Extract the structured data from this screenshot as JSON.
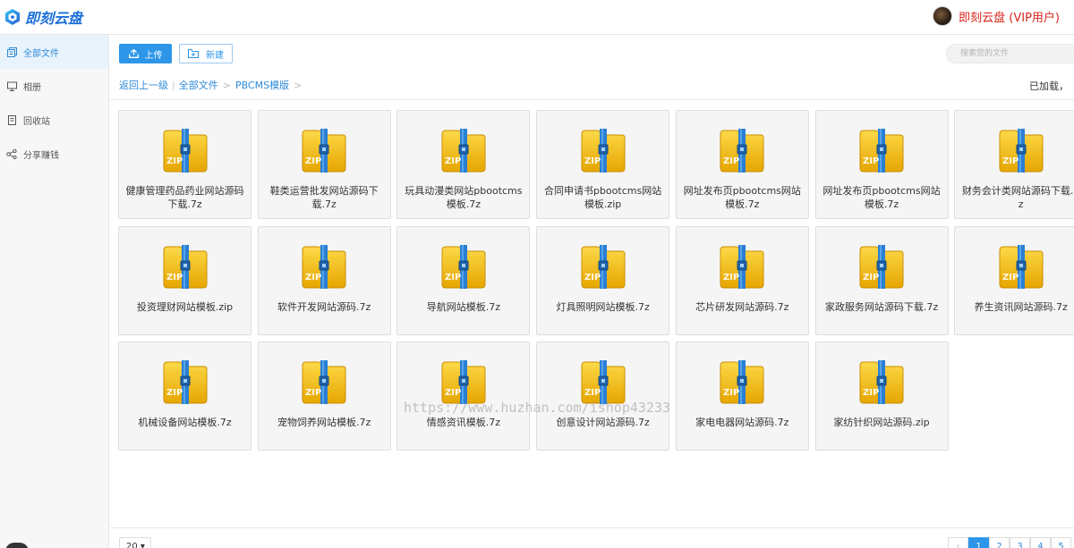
{
  "app": {
    "logo_text": "即刻云盘",
    "user_name": "即刻云盘 (VIP用户)"
  },
  "sidebar": {
    "items": [
      {
        "label": "全部文件",
        "icon": "files-icon",
        "active": true
      },
      {
        "label": "相册",
        "icon": "monitor-icon",
        "active": false
      },
      {
        "label": "回收站",
        "icon": "trash-icon",
        "active": false
      },
      {
        "label": "分享赚钱",
        "icon": "share-icon",
        "active": false
      }
    ]
  },
  "toolbar": {
    "upload_label": "上传",
    "new_label": "新建",
    "search_placeholder": "搜索您的文件"
  },
  "breadcrumb": {
    "back_label": "返回上一级",
    "items": [
      "全部文件",
      "PBCMS模版"
    ],
    "separator": ">",
    "status": "已加载，"
  },
  "files": [
    {
      "name": "健康管理药品药业网站源码下载.7z"
    },
    {
      "name": "鞋类运营批发网站源码下载.7z"
    },
    {
      "name": "玩具动漫类网站pbootcms模板.7z"
    },
    {
      "name": "合同申请书pbootcms网站模板.zip"
    },
    {
      "name": "网址发布页pbootcms网站模板.7z"
    },
    {
      "name": "网址发布页pbootcms网站模板.7z"
    },
    {
      "name": "财务会计类网站源码下载.7z"
    },
    {
      "name": "投资理财网站模板.zip"
    },
    {
      "name": "软件开发网站源码.7z"
    },
    {
      "name": "导航网站模板.7z"
    },
    {
      "name": "灯具照明网站模板.7z"
    },
    {
      "name": "芯片研发网站源码.7z"
    },
    {
      "name": "家政服务网站源码下载.7z"
    },
    {
      "name": "养生资讯网站源码.7z"
    },
    {
      "name": "机械设备网站模板.7z"
    },
    {
      "name": "宠物饲养网站模板.7z"
    },
    {
      "name": "情感资讯模板.7z"
    },
    {
      "name": "创意设计网站源码.7z"
    },
    {
      "name": "家电电器网站源码.7z"
    },
    {
      "name": "家纺针织网站源码.zip"
    }
  ],
  "file_icon_label": "ZIP",
  "watermark": "https://www.huzhan.com/ishop43233",
  "footer": {
    "page_size": "20",
    "pages": [
      "‹",
      "1",
      "2",
      "3",
      "4",
      "5"
    ],
    "current_page": "1"
  },
  "colors": {
    "accent": "#2d96e8",
    "user_name": "#d9241c",
    "zip_body": "#f2b807",
    "zip_strap": "#2a7fd4"
  }
}
